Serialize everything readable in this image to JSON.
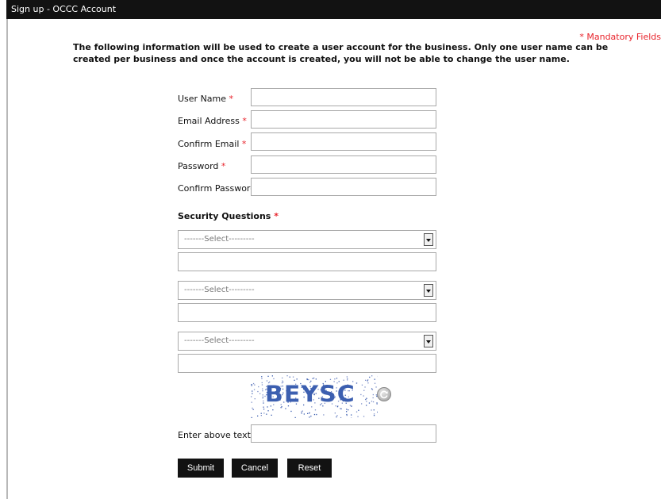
{
  "window": {
    "title": "Sign up - OCCC Account"
  },
  "mandatory_note": "* Mandatory Fields",
  "intro_text": "The following information will be used to create a user account for the business. Only one user name can be created per business and once the account is created, you will not be able to change the user name.",
  "required_mark": "*",
  "fields": [
    {
      "label": "User Name",
      "value": ""
    },
    {
      "label": "Email Address",
      "value": ""
    },
    {
      "label": "Confirm Email",
      "value": ""
    },
    {
      "label": "Password",
      "value": ""
    },
    {
      "label": "Confirm Password",
      "value": ""
    }
  ],
  "security": {
    "title": "Security Questions",
    "questions": [
      {
        "selected": "-------Select---------",
        "answer": ""
      },
      {
        "selected": "-------Select---------",
        "answer": ""
      },
      {
        "selected": "-------Select---------",
        "answer": ""
      }
    ]
  },
  "captcha": {
    "text": "BEYSC",
    "refresh_icon": "refresh-icon",
    "label": "Enter above text",
    "value": ""
  },
  "buttons": {
    "submit": "Submit",
    "cancel": "Cancel",
    "reset": "Reset"
  },
  "colors": {
    "title_bar": "#121212",
    "required": "#e8232b",
    "button_bg": "#121212",
    "captcha_text": "#3c5fb0"
  }
}
